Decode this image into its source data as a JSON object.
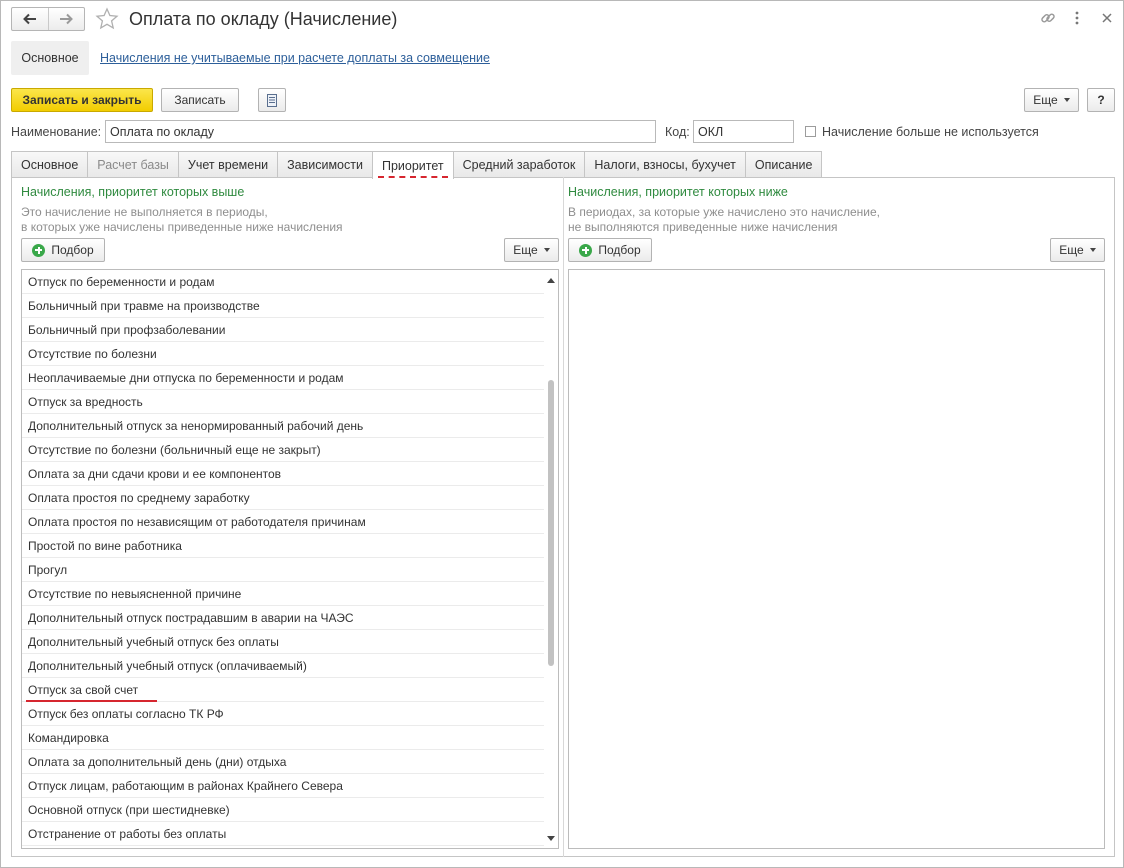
{
  "window": {
    "title": "Оплата по окладу (Начисление)"
  },
  "header": {
    "back_icon": "arrow-left-icon",
    "forward_icon": "arrow-right-icon",
    "favorite_icon": "star-icon",
    "link_icon": "link-icon",
    "more_icon": "vertical-dots-icon",
    "close_icon": "close-icon"
  },
  "sections": {
    "main": "Основное",
    "link": "Начисления не учитываемые при расчете доплаты за совмещение"
  },
  "toolbar": {
    "save_close": "Записать и закрыть",
    "save": "Записать",
    "more": "Еще",
    "help": "?"
  },
  "fields": {
    "name_label": "Наименование:",
    "name_value": "Оплата по окладу",
    "code_label": "Код:",
    "code_value": "ОКЛ",
    "not_used_label": "Начисление больше не используется",
    "not_used_checked": false
  },
  "tabs": [
    {
      "label": "Основное",
      "state": "normal"
    },
    {
      "label": "Расчет базы",
      "state": "disabled"
    },
    {
      "label": "Учет времени",
      "state": "normal"
    },
    {
      "label": "Зависимости",
      "state": "normal"
    },
    {
      "label": "Приоритет",
      "state": "active"
    },
    {
      "label": "Средний заработок",
      "state": "normal"
    },
    {
      "label": "Налоги, взносы, бухучет",
      "state": "normal"
    },
    {
      "label": "Описание",
      "state": "normal"
    }
  ],
  "left_panel": {
    "title": "Начисления, приоритет которых выше",
    "hint_line1": "Это начисление не выполняется в периоды,",
    "hint_line2": "в которых уже начислены приведенные ниже начисления",
    "pick_button": "Подбор",
    "more_button": "Еще",
    "items": [
      "Отпуск по беременности и родам",
      "Больничный при травме на производстве",
      "Больничный при профзаболевании",
      "Отсутствие по болезни",
      "Неоплачиваемые дни отпуска по беременности и родам",
      "Отпуск за вредность",
      "Дополнительный отпуск за ненормированный рабочий день",
      "Отсутствие по болезни (больничный еще не закрыт)",
      "Оплата за дни сдачи крови и ее компонентов",
      "Оплата простоя по среднему заработку",
      "Оплата простоя по независящим от работодателя причинам",
      "Простой по вине работника",
      "Прогул",
      "Отсутствие по невыясненной причине",
      "Дополнительный отпуск пострадавшим в аварии на ЧАЭС",
      "Дополнительный учебный отпуск без оплаты",
      "Дополнительный учебный отпуск (оплачиваемый)",
      "Отпуск за свой счет",
      "Отпуск без оплаты согласно ТК РФ",
      "Командировка",
      "Оплата за дополнительный день (дни) отдыха",
      "Отпуск лицам, работающим в районах Крайнего Севера",
      "Основной отпуск (при шестидневке)",
      "Отстранение от работы без оплаты"
    ],
    "highlighted_item_index": 17
  },
  "right_panel": {
    "title": "Начисления, приоритет которых ниже",
    "hint_line1": "В периодах, за которые уже начислено это начисление,",
    "hint_line2": "не выполняются приведенные ниже начисления",
    "pick_button": "Подбор",
    "more_button": "Еще",
    "items": []
  },
  "colors": {
    "primary_button": "#f5d30a",
    "link": "#2d5f9a",
    "green_title": "#2f8a3f",
    "add_icon": "#3aa84a",
    "highlight_red": "#d6262f"
  }
}
